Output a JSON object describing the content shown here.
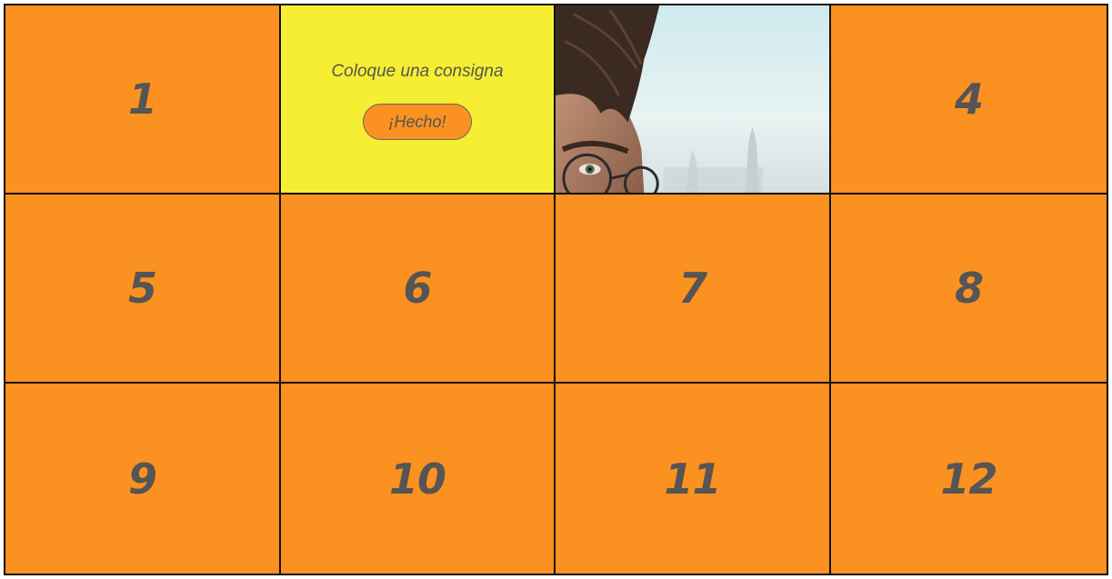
{
  "board": {
    "tiles": [
      {
        "label": "1"
      },
      {
        "label": ""
      },
      {
        "label": ""
      },
      {
        "label": "4"
      },
      {
        "label": "5"
      },
      {
        "label": "6"
      },
      {
        "label": "7"
      },
      {
        "label": "8"
      },
      {
        "label": "9"
      },
      {
        "label": "10"
      },
      {
        "label": "11"
      },
      {
        "label": "12"
      }
    ],
    "prompt": {
      "text": "Coloque una consigna",
      "button_label": "¡Hecho!"
    },
    "revealed_image": {
      "icon": "portrait-image"
    }
  },
  "colors": {
    "tile": "#fb9120",
    "prompt_tile": "#f6ee33",
    "number_text": "#555555",
    "border": "#111111"
  }
}
